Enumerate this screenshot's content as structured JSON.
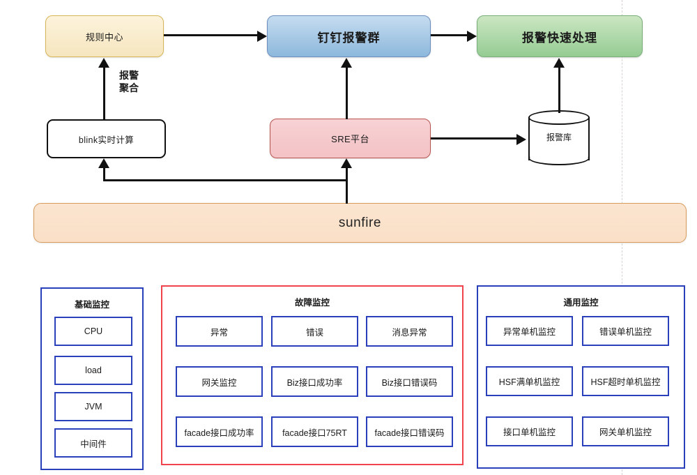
{
  "diagram": {
    "nodes": {
      "rule_center": "规则中心",
      "dingding_alarm_group": "钉钉报警群",
      "fast_handle": "报警快速处理",
      "blink_realtime": "blink实时计算",
      "sre_platform": "SRE平台",
      "alarm_db": "报警库",
      "sunfire": "sunfire"
    },
    "edge_labels": {
      "alarm_aggregation_line1": "报警",
      "alarm_aggregation_line2": "聚合"
    },
    "colors": {
      "rule_center_border": "#d6b656",
      "rule_center_fill": "#f6e6bf",
      "dingding_border": "#6c8ebf",
      "dingding_fill": "#8db8dc",
      "handle_border": "#79ae79",
      "handle_fill": "#95cc93",
      "sre_border": "#b85450",
      "sre_fill": "#f3c2c5",
      "sunfire_border": "#d79b5b",
      "sunfire_fill": "#fadfc6",
      "panel_blue": "#2940ba",
      "panel_red": "#f0434b",
      "edge": "#111111"
    }
  },
  "panels": {
    "basic": {
      "title": "基础监控",
      "items": [
        "CPU",
        "load",
        "JVM",
        "中间件"
      ]
    },
    "fault": {
      "title": "故障监控",
      "items": [
        "异常",
        "错误",
        "消息异常",
        "网关监控",
        "Biz接口成功率",
        "Biz接口错误码",
        "facade接口成功率",
        "facade接口75RT",
        "facade接口错误码"
      ]
    },
    "common": {
      "title": "通用监控",
      "items": [
        "异常单机监控",
        "错误单机监控",
        "HSF满单机监控",
        "HSF超时单机监控",
        "接口单机监控",
        "网关单机监控"
      ]
    }
  }
}
